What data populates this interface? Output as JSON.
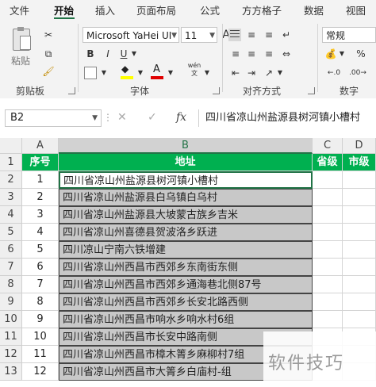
{
  "tabs": [
    "文件",
    "开始",
    "插入",
    "页面布局",
    "公式",
    "方方格子",
    "数据",
    "视图"
  ],
  "active_tab": "开始",
  "ribbon": {
    "clipboard": {
      "paste_label": "粘贴",
      "group_label": "剪贴板"
    },
    "font": {
      "font_name": "Microsoft YaHei UI",
      "font_size": "11",
      "group_label": "字体",
      "bold": "B",
      "italic": "I",
      "underline": "U",
      "size_up": "A",
      "size_down": "A",
      "font_color_glyph": "A",
      "phonetic_glyph": "wén"
    },
    "alignment": {
      "group_label": "对齐方式"
    },
    "number": {
      "format": "常规",
      "group_label": "数字"
    }
  },
  "formula_bar": {
    "name_box": "B2",
    "cancel": "✕",
    "confirm": "✓",
    "fx": "fx",
    "content": "四川省凉山州盐源县树河镇小槽村"
  },
  "columns": [
    "A",
    "B",
    "C",
    "D"
  ],
  "rows": [
    "1",
    "2",
    "3",
    "4",
    "5",
    "6",
    "7",
    "8",
    "9",
    "10",
    "11",
    "12",
    "13"
  ],
  "table": {
    "headers": [
      "序号",
      "地址",
      "省级",
      "市级"
    ],
    "data": [
      {
        "no": "1",
        "addr": "四川省凉山州盐源县树河镇小槽村"
      },
      {
        "no": "2",
        "addr": "四川省凉山州盐源县白乌镇白乌村"
      },
      {
        "no": "3",
        "addr": "四川省凉山州盐源县大坡蒙古族乡吉米"
      },
      {
        "no": "4",
        "addr": "四川省凉山州喜德县贺波洛乡跃进"
      },
      {
        "no": "5",
        "addr": "四川凉山宁南六铁增建"
      },
      {
        "no": "6",
        "addr": "四川省凉山州西昌市西郊乡东南街东侧"
      },
      {
        "no": "7",
        "addr": "四川省凉山州西昌市西郊乡通海巷北侧87号"
      },
      {
        "no": "8",
        "addr": "四川省凉山州西昌市西郊乡长安北路西侧"
      },
      {
        "no": "9",
        "addr": "四川省凉山州西昌市响水乡响水村6组"
      },
      {
        "no": "10",
        "addr": "四川省凉山州西昌市长安中路南侧"
      },
      {
        "no": "11",
        "addr": "四川省凉山州西昌市樟木箐乡麻柳村7组"
      },
      {
        "no": "12",
        "addr": "四川省凉山州西昌市大箐乡白庙村-组"
      }
    ]
  },
  "watermark": "软件技巧",
  "colors": {
    "accent": "#217346",
    "header_fill": "#00b050",
    "address_fill": "#c8c8c8"
  }
}
